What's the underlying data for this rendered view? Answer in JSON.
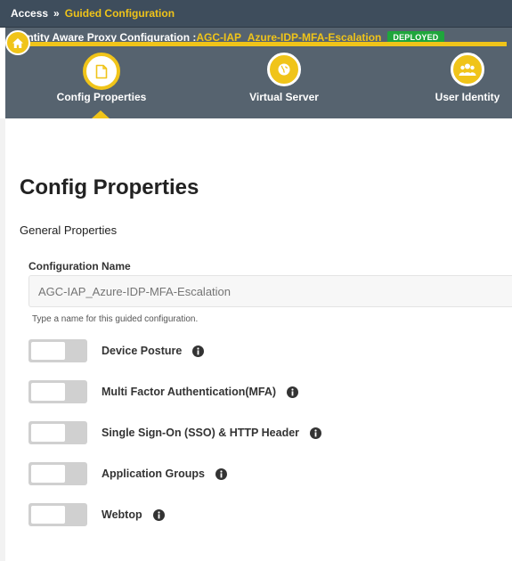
{
  "breadcrumb": {
    "root": "Access",
    "separator": "»",
    "current": "Guided Configuration"
  },
  "header": {
    "title_prefix": "Identity Aware Proxy Configuration :",
    "config_name": "AGC-IAP_Azure-IDP-MFA-Escalation",
    "status_badge": "DEPLOYED"
  },
  "steps": [
    {
      "label": "Config Properties",
      "icon": "document-icon",
      "active": true
    },
    {
      "label": "Virtual Server",
      "icon": "globe-icon",
      "active": false
    },
    {
      "label": "User Identity",
      "icon": "users-icon",
      "active": false
    }
  ],
  "page": {
    "title": "Config Properties",
    "section": "General Properties",
    "config_name_label": "Configuration Name",
    "config_name_placeholder": "AGC-IAP_Azure-IDP-MFA-Escalation",
    "config_name_help": "Type a name for this guided configuration."
  },
  "toggles": [
    {
      "label": "Device Posture",
      "enabled": false
    },
    {
      "label": "Multi Factor Authentication(MFA)",
      "enabled": false
    },
    {
      "label": "Single Sign-On (SSO) & HTTP Header",
      "enabled": false
    },
    {
      "label": "Application Groups",
      "enabled": false
    },
    {
      "label": "Webtop",
      "enabled": false
    }
  ],
  "colors": {
    "accent": "#f0c419",
    "header_bg": "#56636f",
    "breadcrumb_bg": "#3e4d5c",
    "badge_green": "#1fa63c",
    "toggle_off": "#d0d0d0"
  }
}
